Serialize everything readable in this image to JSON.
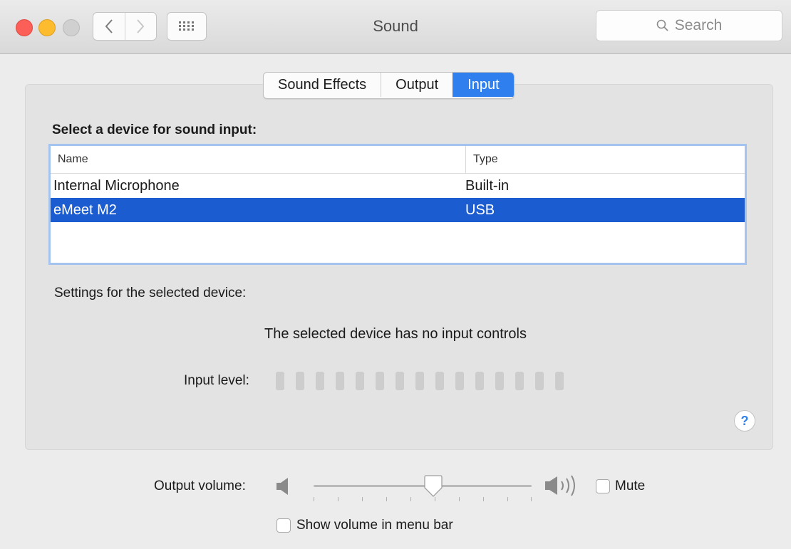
{
  "window": {
    "title": "Sound"
  },
  "search": {
    "placeholder": "Search"
  },
  "tabs": [
    {
      "label": "Sound Effects",
      "active": false
    },
    {
      "label": "Output",
      "active": false
    },
    {
      "label": "Input",
      "active": true
    }
  ],
  "input": {
    "section_label": "Select a device for sound input:",
    "columns": [
      "Name",
      "Type"
    ],
    "devices": [
      {
        "name": "Internal Microphone",
        "type": "Built-in",
        "selected": false
      },
      {
        "name": "eMeet M2",
        "type": "USB",
        "selected": true
      }
    ],
    "settings_label": "Settings for the selected device:",
    "no_controls_text": "The selected device has no input controls",
    "level_label": "Input level:",
    "level_segments": 15,
    "level_value": 0
  },
  "output_volume": {
    "label": "Output volume:",
    "value_fraction": 0.55,
    "mute_label": "Mute",
    "mute_checked": false
  },
  "show_volume": {
    "label": "Show volume in menu bar",
    "checked": false
  },
  "colors": {
    "accent": "#2f80ee",
    "selection": "#1c5cd1",
    "panel": "#e3e3e3"
  },
  "icons": [
    "back-icon",
    "forward-icon",
    "grid-icon",
    "search-icon",
    "speaker-low-icon",
    "speaker-high-icon",
    "help-icon"
  ]
}
